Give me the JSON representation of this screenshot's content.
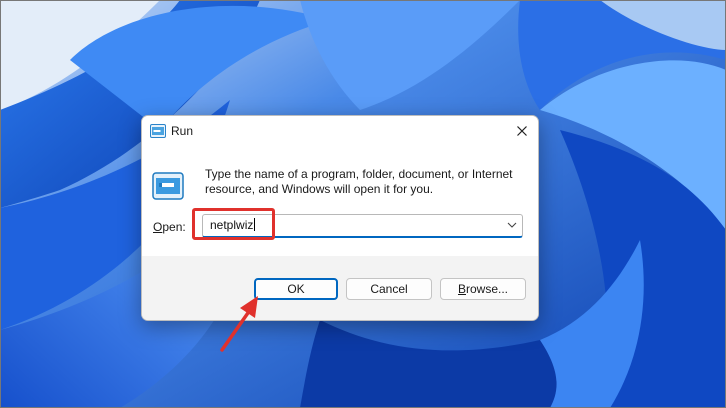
{
  "dialog": {
    "title": "Run",
    "description": "Type the name of a program, folder, document, or Internet resource, and Windows will open it for you.",
    "open_label_accel": "O",
    "open_label_rest": "pen:",
    "open_value": "netplwiz",
    "ok_label": "OK",
    "cancel_label": "Cancel",
    "browse_label_accel": "B",
    "browse_label_rest": "rowse..."
  },
  "icons": {
    "title": "run-icon",
    "body": "run-large-icon",
    "close": "close-icon",
    "dropdown": "chevron-down-icon",
    "annotation": "red-arrow"
  },
  "colors": {
    "accent": "#0067c0",
    "highlight": "#e0312c",
    "wallpaper": "#1c5ed6"
  }
}
